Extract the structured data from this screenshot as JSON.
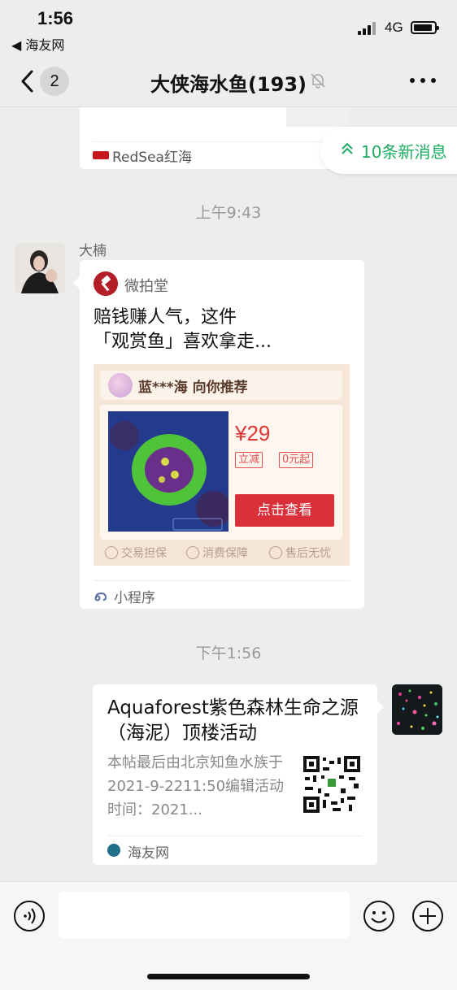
{
  "status_bar": {
    "time": "1:56",
    "back_app": "◀ 海友网",
    "network": "4G"
  },
  "nav": {
    "unread_count": "2",
    "title": "大侠海水鱼(193)"
  },
  "top_card": {
    "source": "RedSea红海"
  },
  "new_messages": {
    "label": "10条新消息"
  },
  "timestamps": {
    "first": "上午9:43",
    "second": "下午1:56"
  },
  "message1": {
    "sender": "大楠",
    "mini_program": {
      "name": "微拍堂",
      "title_line1": "赔钱赚人气，这件",
      "title_line2": "「观赏鱼」喜欢拿走...",
      "recommend": "蓝***海 向你推荐",
      "price": "¥29",
      "tag1": "立减",
      "tag2": "0元起",
      "button": "点击查看",
      "guarantees": [
        "交易担保",
        "消费保障",
        "售后无忧"
      ],
      "footer": "小程序"
    }
  },
  "message2": {
    "link_card": {
      "title": "Aquaforest紫色森林生命之源（海泥）顶楼活动",
      "description": "本帖最后由北京知鱼水族于2021-9-2211:50编辑活动时间：2021...",
      "source": "海友网"
    }
  },
  "icons": {
    "back": "chevron-left-icon",
    "mute": "bell-off-icon",
    "more": "more-icon",
    "voice": "voice-icon",
    "emoji": "emoji-icon",
    "plus": "plus-icon"
  },
  "colors": {
    "accent_green": "#1aad5f",
    "price_red": "#e03535",
    "button_red": "#d9303a"
  }
}
